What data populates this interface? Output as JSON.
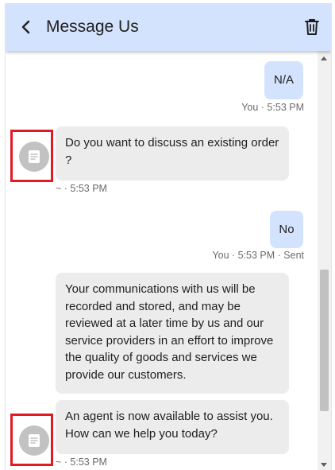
{
  "header": {
    "title": "Message Us",
    "back_icon": "chevron-left-icon",
    "delete_icon": "trash-icon",
    "background": "#d3e3fd"
  },
  "messages": [
    {
      "sender": "user",
      "text": "N/A",
      "meta": "You · 5:53 PM"
    },
    {
      "sender": "agent",
      "text": "Do you want to discuss an existing order ?",
      "meta": "~ · 5:53 PM"
    },
    {
      "sender": "user",
      "text": "No",
      "meta": "You · 5:53 PM · Sent"
    },
    {
      "sender": "agent",
      "text": "Your communications with us will be recorded and stored, and may be reviewed at a later time by us and our service providers in an effort to improve the quality of goods and services we provide our customers."
    },
    {
      "sender": "agent",
      "text": "An agent is now available to assist you. How can we help you today?",
      "meta": "~ · 5:53 PM"
    }
  ],
  "colors": {
    "user_bubble": "#d3e3fd",
    "agent_bubble": "#ececec",
    "highlight_box": "#e01b24"
  }
}
